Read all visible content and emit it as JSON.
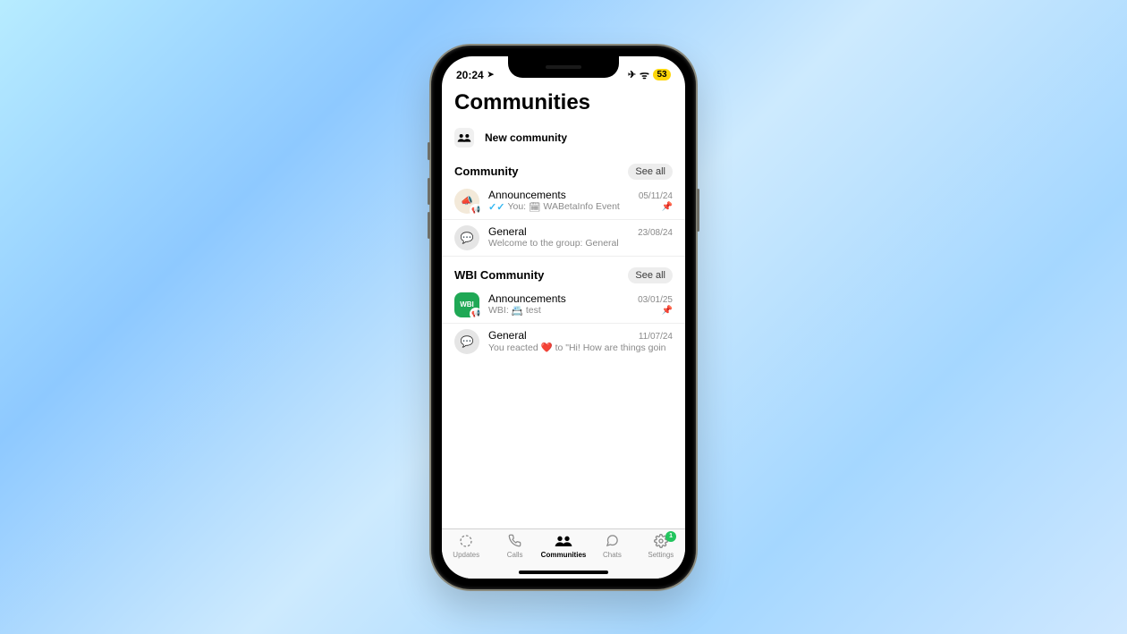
{
  "status": {
    "time": "20:24",
    "location_glyph": "➤",
    "airplane_glyph": "✈",
    "wifi_glyph": "ᯤ",
    "battery": "53"
  },
  "header": {
    "title": "Communities",
    "new_label": "New community",
    "new_icon_name": "people-icon"
  },
  "sections": [
    {
      "title": "Community",
      "see_all": "See all",
      "items": [
        {
          "name": "Announcements",
          "date": "05/11/24",
          "preview_prefix_ticks": true,
          "preview_you": "You:",
          "preview_icon": "🗓",
          "preview_text": "WABetaInfo Event",
          "pinned": true,
          "avatar_type": "round_megaphone",
          "avatar_glyph": "📣"
        },
        {
          "name": "General",
          "date": "23/08/24",
          "preview_text": "Welcome to the group: General",
          "pinned": false,
          "avatar_type": "round_chat",
          "avatar_glyph": "💬"
        }
      ]
    },
    {
      "title": "WBI Community",
      "see_all": "See all",
      "items": [
        {
          "name": "Announcements",
          "date": "03/01/25",
          "preview_you": "WBI:",
          "preview_icon": "📇",
          "preview_text": "test",
          "pinned": true,
          "avatar_type": "square_wbi",
          "avatar_label": "WBI"
        },
        {
          "name": "General",
          "date": "11/07/24",
          "preview_text": "You reacted ❤️ to \"Hi! How are things goin",
          "pinned": false,
          "avatar_type": "round_chat",
          "avatar_glyph": "💬"
        }
      ]
    }
  ],
  "tabs": [
    {
      "label": "Updates",
      "icon": "◌",
      "active": false
    },
    {
      "label": "Calls",
      "icon": "✆",
      "active": false
    },
    {
      "label": "Communities",
      "icon": "👥",
      "active": true
    },
    {
      "label": "Chats",
      "icon": "💬",
      "active": false
    },
    {
      "label": "Settings",
      "icon": "⚙",
      "active": false,
      "badge": "1"
    }
  ]
}
